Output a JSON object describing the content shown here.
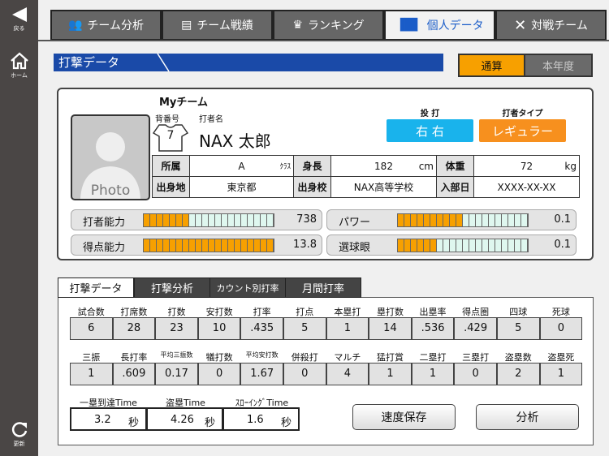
{
  "sidebar": {
    "back": "戻る",
    "home": "ホーム",
    "refresh": "更新"
  },
  "tabs": [
    {
      "label": "チーム分析"
    },
    {
      "label": "チーム戦績"
    },
    {
      "label": "ランキング"
    },
    {
      "label": "個人データ"
    },
    {
      "label": "対戦チーム"
    }
  ],
  "section_title": "打撃データ",
  "period": {
    "total": "通算",
    "this_year": "本年度"
  },
  "profile": {
    "team": "Myチーム",
    "number_label": "背番号",
    "name_label": "打者名",
    "number": "7",
    "name": "NAX 太郎",
    "photo": "Photo",
    "throw_bat_label": "投 打",
    "throw_bat": "右 右",
    "type_label": "打者タイプ",
    "type": "レギュラー",
    "info": [
      [
        "所属",
        "A",
        "ｸﾗｽ",
        "身長",
        "182",
        "cm",
        "体重",
        "72",
        "kg"
      ],
      [
        "出身地",
        "東京都",
        "",
        "出身校",
        "NAX高等学校",
        "",
        "入部日",
        "XXXX-XX-XX",
        ""
      ]
    ]
  },
  "abilities": [
    {
      "label": "打者能力",
      "value": "738",
      "filled": 7,
      "total": 20
    },
    {
      "label": "パワー",
      "value": "0.1",
      "filled": 10,
      "total": 20
    },
    {
      "label": "得点能力",
      "value": "13.8",
      "filled": 20,
      "total": 20
    },
    {
      "label": "選球眼",
      "value": "0.1",
      "filled": 6,
      "total": 20
    }
  ],
  "lower_tabs": [
    "打撃データ",
    "打撃分析",
    "カウント別打率",
    "月間打率"
  ],
  "stats1": {
    "headers": [
      "試合数",
      "打席数",
      "打数",
      "安打数",
      "打率",
      "打点",
      "本塁打",
      "塁打数",
      "出塁率",
      "得点圏",
      "四球",
      "死球"
    ],
    "values": [
      "6",
      "28",
      "23",
      "10",
      ".435",
      "5",
      "1",
      "14",
      ".536",
      ".429",
      "5",
      "0"
    ]
  },
  "stats2": {
    "headers": [
      "三振",
      "長打率",
      "平均三振数",
      "犠打数",
      "平均安打数",
      "併殺打",
      "マルチ",
      "猛打賞",
      "二塁打",
      "三塁打",
      "盗塁数",
      "盗塁死"
    ],
    "values": [
      "1",
      ".609",
      "0.17",
      "0",
      "1.67",
      "0",
      "4",
      "1",
      "1",
      "0",
      "2",
      "1"
    ]
  },
  "times": [
    {
      "label": "一塁到達Time",
      "value": "3.2",
      "unit": "秒"
    },
    {
      "label": "盗塁Time",
      "value": "4.26",
      "unit": "秒"
    },
    {
      "label": "ｽﾛｰｲﾝｸﾞTime",
      "value": "1.6",
      "unit": "秒"
    }
  ],
  "buttons": {
    "save_speed": "速度保存",
    "analyze": "分析"
  },
  "colors": {
    "accent_blue": "#1a4aa8",
    "orange": "#f7a000",
    "cyan": "#19b3ec"
  }
}
